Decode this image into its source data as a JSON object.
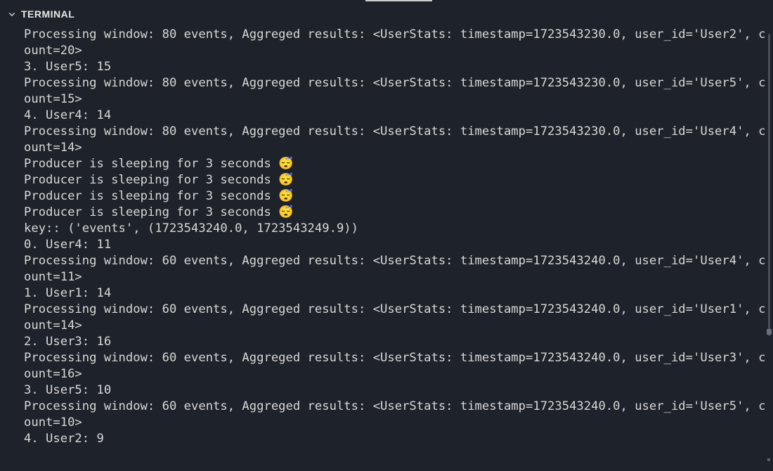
{
  "header": {
    "title": "TERMINAL"
  },
  "lines": [
    "Processing window: 80 events, Aggreged results: <UserStats: timestamp=1723543230.0, user_id='User2', count=20>",
    "3. User5: 15",
    "Processing window: 80 events, Aggreged results: <UserStats: timestamp=1723543230.0, user_id='User5', count=15>",
    "4. User4: 14",
    "Processing window: 80 events, Aggreged results: <UserStats: timestamp=1723543230.0, user_id='User4', count=14>",
    "Producer is sleeping for 3 seconds 😴",
    "Producer is sleeping for 3 seconds 😴",
    "Producer is sleeping for 3 seconds 😴",
    "Producer is sleeping for 3 seconds 😴",
    "key:: ('events', (1723543240.0, 1723543249.9))",
    "0. User4: 11",
    "Processing window: 60 events, Aggreged results: <UserStats: timestamp=1723543240.0, user_id='User4', count=11>",
    "1. User1: 14",
    "Processing window: 60 events, Aggreged results: <UserStats: timestamp=1723543240.0, user_id='User1', count=14>",
    "2. User3: 16",
    "Processing window: 60 events, Aggreged results: <UserStats: timestamp=1723543240.0, user_id='User3', count=16>",
    "3. User5: 10",
    "Processing window: 60 events, Aggreged results: <UserStats: timestamp=1723543240.0, user_id='User5', count=10>",
    "4. User2: 9"
  ]
}
